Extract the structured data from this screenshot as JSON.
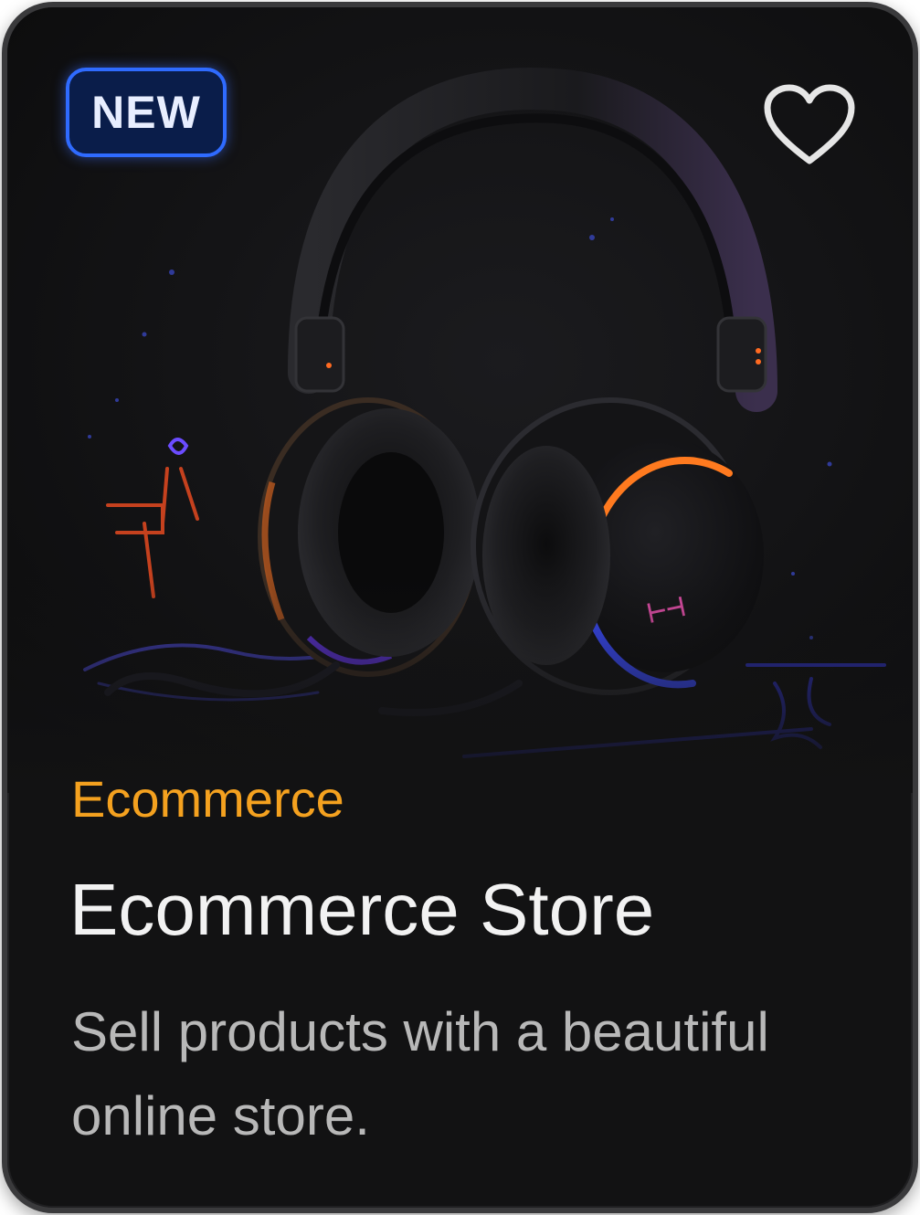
{
  "card": {
    "badge": "NEW",
    "category": "Ecommerce",
    "title": "Ecommerce Store",
    "description": "Sell products with a beautiful online store."
  },
  "hero": {
    "image_subject": "over-ear headphones on a dark surface with neon glow accents",
    "earcup_logo": "⊢⊣"
  },
  "icons": {
    "favorite": "heart-outline-icon"
  },
  "colors": {
    "card_background": "#121213",
    "badge_border": "#2f6bff",
    "category_text": "#f4a11f",
    "title_text": "#f2f2f2",
    "description_text": "#b8b8b8"
  }
}
